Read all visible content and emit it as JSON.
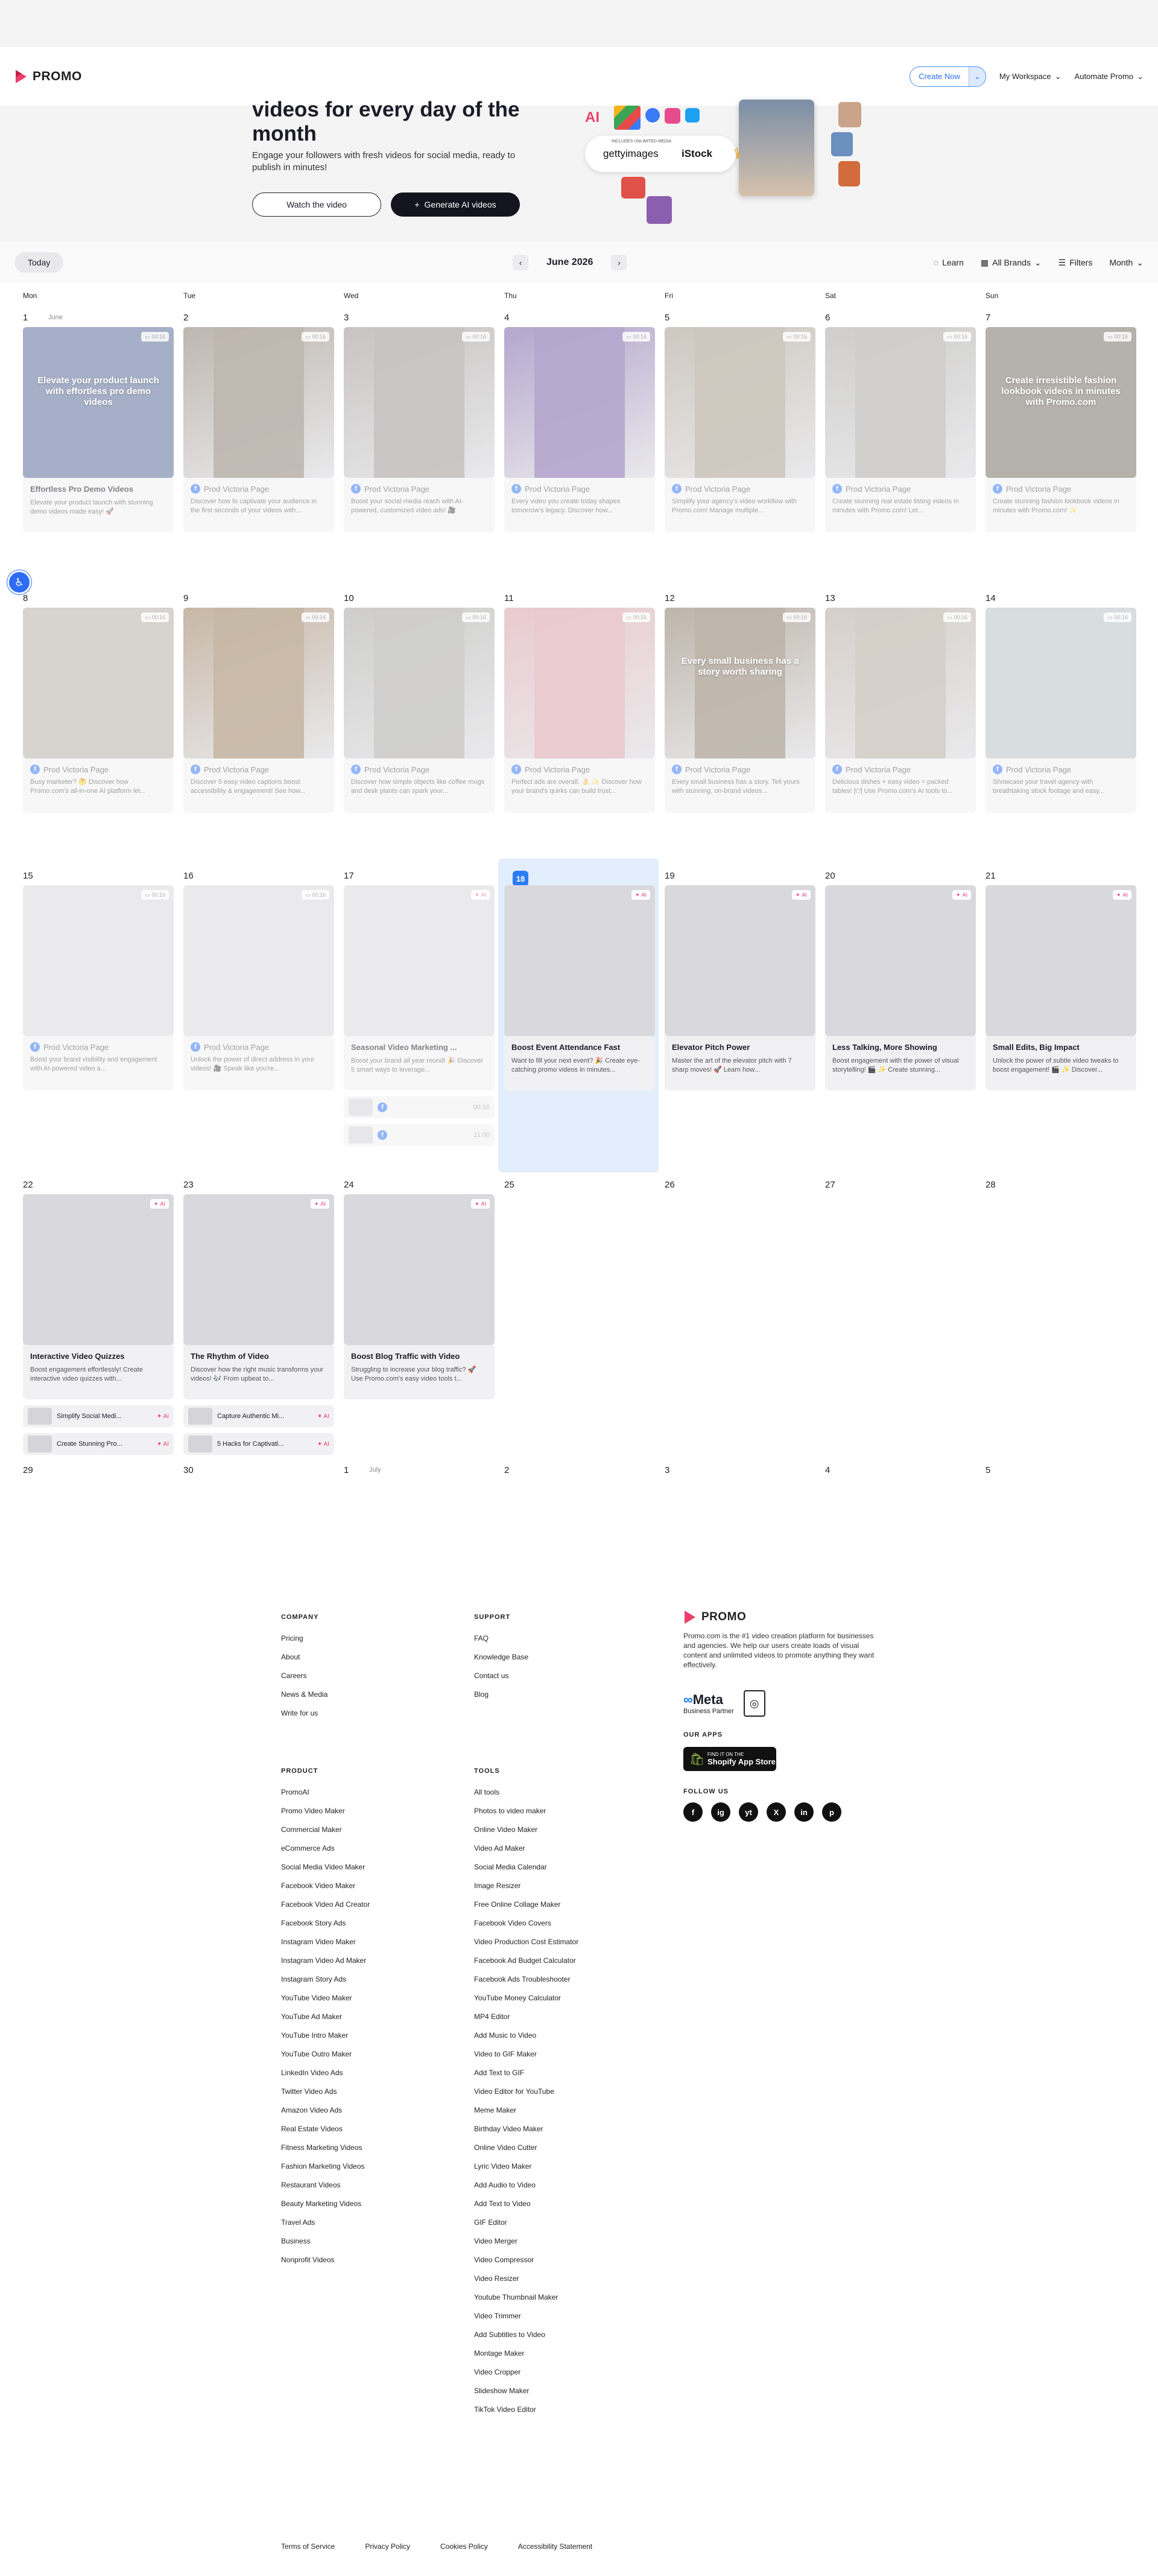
{
  "brand": {
    "name": "PROMO",
    "accent": "#ea3f6c",
    "blue": "#2e7bf6"
  },
  "nav": {
    "create_now": "Create Now",
    "workspace": "My Workspace",
    "automate": "Automate Promo"
  },
  "hero": {
    "title": "videos for every day of the month",
    "subtitle": "Engage your followers with fresh videos for social media, ready to publish in minutes!",
    "watch_btn": "Watch the video",
    "generate_btn": "Generate AI videos",
    "getty_top": "INCLUDES UNLIMITED MEDIA",
    "getty": "gettyimages",
    "istock": "iStock"
  },
  "toolbar": {
    "today": "Today",
    "month_label": "June 2026",
    "learn": "Learn",
    "brands": "All Brands",
    "filters": "Filters",
    "view": "Month"
  },
  "daynames": [
    "Mon",
    "Tue",
    "Wed",
    "Thu",
    "Fri",
    "Sat",
    "Sun"
  ],
  "weeks": [
    {
      "days": [
        {
          "num": "1",
          "sub": "June",
          "title": "Effortless Pro Demo Videos",
          "desc": "Elevate your product launch with stunning demo videos made easy! 🚀",
          "dur": "00:16",
          "thumb": "#5d6f9a",
          "overlay": "Elevate your product launch with effortless pro demo videos"
        },
        {
          "num": "2",
          "page": "Prod Victoria Page",
          "desc": "Discover how to captivate your audience in the first seconds of your videos with...",
          "dur": "00:16",
          "thumb": "#8a7d70"
        },
        {
          "num": "3",
          "page": "Prod Victoria Page",
          "desc": "Boost your social media reach with AI-powered, customized video ads! 🎥",
          "dur": "00:16",
          "thumb": "#9a9490"
        },
        {
          "num": "4",
          "page": "Prod Victoria Page",
          "desc": "Every video you create today shapes tomorrow's legacy. Discover how...",
          "dur": "00:16",
          "thumb": "#7a5fa6"
        },
        {
          "num": "5",
          "page": "Prod Victoria Page",
          "desc": "Simplify your agency's video workflow with Promo.com! Manage multiple...",
          "dur": "00:16",
          "thumb": "#a59a8a"
        },
        {
          "num": "6",
          "page": "Prod Victoria Page",
          "desc": "Create stunning real estate listing videos in minutes with Promo.com! Let...",
          "dur": "00:16",
          "thumb": "#a8a6a2"
        },
        {
          "num": "7",
          "page": "Prod Victoria Page",
          "desc": "Create stunning fashion lookbook videos in minutes with Promo.com! ✨",
          "dur": "00:16",
          "thumb": "#7a7268",
          "overlay": "Create irresistible fashion lookbook videos in minutes with Promo.com"
        }
      ]
    },
    {
      "days": [
        {
          "num": "8",
          "page": "Prod Victoria Page",
          "desc": "Busy marketer? 🤔 Discover how Promo.com's all-in-one AI platform let...",
          "dur": "00:16",
          "thumb": "#b7b2aa"
        },
        {
          "num": "9",
          "page": "Prod Victoria Page",
          "desc": "Discover 5 easy video captions boost accessibility & engagement! See how...",
          "dur": "00:16",
          "thumb": "#9a7e5e"
        },
        {
          "num": "10",
          "page": "Prod Victoria Page",
          "desc": "Discover how simple objects like coffee mugs and desk plants can spark your...",
          "dur": "00:16",
          "thumb": "#a7a6a2"
        },
        {
          "num": "11",
          "page": "Prod Victoria Page",
          "desc": "Perfect ads are overall. 👌 ✨ Discover how your brand's quirks can build trust...",
          "dur": "00:16",
          "thumb": "#d8a0a8"
        },
        {
          "num": "12",
          "page": "Prod Victoria Page",
          "desc": "Every small business has a story. Tell yours with stunning, on-brand videos...",
          "dur": "00:16",
          "thumb": "#8a7a66",
          "overlay": "Every small business has a story worth sharing"
        },
        {
          "num": "13",
          "page": "Prod Victoria Page",
          "desc": "Delicious dishes + easy video = packed tables! 🍽 Use Promo.com's AI tools to...",
          "dur": "00:16",
          "thumb": "#b4a89c"
        },
        {
          "num": "14",
          "page": "Prod Victoria Page",
          "desc": "Showcase your travel agency with breathtaking stock footage and easy...",
          "dur": "00:16",
          "thumb": "#b9c2c6"
        }
      ]
    },
    {
      "days": [
        {
          "num": "15",
          "page": "Prod Victoria Page",
          "desc": "Boost your brand visibility and engagement with AI-powered video a...",
          "dur": "00:16"
        },
        {
          "num": "16",
          "page": "Prod Victoria Page",
          "desc": "Unlock the power of direct address in your videos! 🎥 Speak like you're...",
          "dur": "00:16"
        },
        {
          "num": "17",
          "title": "Seasonal Video Marketing ...",
          "desc": "Boost your brand all year round! 🎉 Discover 5 smart ways to leverage...",
          "ai": true,
          "minis": [
            {
              "dur": "00:16"
            },
            {
              "dur": "11:00"
            }
          ]
        },
        {
          "num": "18",
          "today": true,
          "title": "Boost Event Attendance Fast",
          "desc": "Want to fill your next event? 🎉 Create eye-catching promo videos in minutes...",
          "ai": true
        },
        {
          "num": "19",
          "title": "Elevator Pitch Power",
          "desc": "Master the art of the elevator pitch with 7 sharp moves! 🚀 Learn how...",
          "ai": true
        },
        {
          "num": "20",
          "title": "Less Talking, More Showing",
          "desc": "Boost engagement with the power of visual storytelling! 🎬 ✨ Create stunning...",
          "ai": true
        },
        {
          "num": "21",
          "title": "Small Edits, Big Impact",
          "desc": "Unlock the power of subtle video tweaks to boost engagement! 🎬 ✨ Discover...",
          "ai": true
        }
      ]
    },
    {
      "days": [
        {
          "num": "22",
          "title": "Interactive Video Quizzes",
          "desc": "Boost engagement effortlessly! Create interactive video quizzes with...",
          "ai": true,
          "minis": [
            {
              "label": "Simplify Social Medi...",
              "ai": "AI"
            },
            {
              "label": "Create Stunning Pro...",
              "ai": "AI"
            }
          ]
        },
        {
          "num": "23",
          "title": "The Rhythm of Video",
          "desc": "Discover how the right music transforms your videos! 🎶 From upbeat to...",
          "ai": true,
          "minis": [
            {
              "label": "Capture Authentic Mi...",
              "ai": "AI"
            },
            {
              "label": "5 Hacks for Captivati...",
              "ai": "AI"
            }
          ]
        },
        {
          "num": "24",
          "title": "Boost Blog Traffic with Video",
          "desc": "Struggling to increase your blog traffic? 🚀 Use Promo.com's easy video tools t...",
          "ai": true
        },
        {
          "num": "25"
        },
        {
          "num": "26"
        },
        {
          "num": "27"
        },
        {
          "num": "28"
        }
      ]
    },
    {
      "days": [
        {
          "num": "29"
        },
        {
          "num": "30"
        },
        {
          "num": "1",
          "sub": "July"
        },
        {
          "num": "2"
        },
        {
          "num": "3"
        },
        {
          "num": "4"
        },
        {
          "num": "5"
        }
      ]
    }
  ],
  "ai_label": "AI",
  "footer": {
    "company": {
      "head": "COMPANY",
      "links": [
        "Pricing",
        "About",
        "Careers",
        "News & Media",
        "Write for us"
      ]
    },
    "support": {
      "head": "SUPPORT",
      "links": [
        "FAQ",
        "Knowledge Base",
        "Contact us",
        "Blog"
      ]
    },
    "product": {
      "head": "PRODUCT",
      "links": [
        "PromoAI",
        "Promo Video Maker",
        "Commercial Maker",
        "eCommerce Ads",
        "Social Media Video Maker",
        "Facebook Video Maker",
        "Facebook Video Ad Creator",
        "Facebook Story Ads",
        "Instagram Video Maker",
        "Instagram Video Ad Maker",
        "Instagram Story Ads",
        "YouTube Video Maker",
        "YouTube Ad Maker",
        "YouTube Intro Maker",
        "YouTube Outro Maker",
        "LinkedIn Video Ads",
        "Twitter Video Ads",
        "Amazon Video Ads",
        "Real Estate Videos",
        "Fitness Marketing Videos",
        "Fashion Marketing Videos",
        "Restaurant Videos",
        "Beauty Marketing Videos",
        "Travel Ads",
        "Business",
        "Nonprofit Videos"
      ]
    },
    "tools": {
      "head": "TOOLS",
      "links": [
        "All tools",
        "Photos to video maker",
        "Online Video Maker",
        "Video Ad Maker",
        "Social Media Calendar",
        "Image Resizer",
        "Free Online Collage Maker",
        "Facebook Video Covers",
        "Video Production Cost Estimator",
        "Facebook Ad Budget Calculator",
        "Facebook Ads Troubleshooter",
        "YouTube Money Calculator",
        "MP4 Editor",
        "Add Music to Video",
        "Video to GIF Maker",
        "Add Text to GIF",
        "Video Editor for YouTube",
        "Meme Maker",
        "Birthday Video Maker",
        "Online Video Cutter",
        "Lyric Video Maker",
        "Add Audio to Video",
        "Add Text to Video",
        "GIF Editor",
        "Video Merger",
        "Video Compressor",
        "Video Resizer",
        "Youtube Thumbnail Maker",
        "Video Trimmer",
        "Add Subtitles to Video",
        "Montage Maker",
        "Video Cropper",
        "Slideshow Maker",
        "TikTok Video Editor"
      ]
    },
    "about": "Promo.com is the #1 video creation platform for businesses and agencies. We help our users create loads of visual content and unlimited videos to promote anything they want effectively.",
    "meta": "Meta",
    "meta_sub": "Business Partner",
    "our_apps": "OUR APPS",
    "shopify_small": "FIND IT ON THE",
    "shopify": "Shopify App Store",
    "follow": "FOLLOW US",
    "social": [
      "f",
      "ig",
      "yt",
      "X",
      "in",
      "p"
    ],
    "legal": [
      "Terms of Service",
      "Privacy Policy",
      "Cookies Policy",
      "Accessibility Statement"
    ]
  }
}
